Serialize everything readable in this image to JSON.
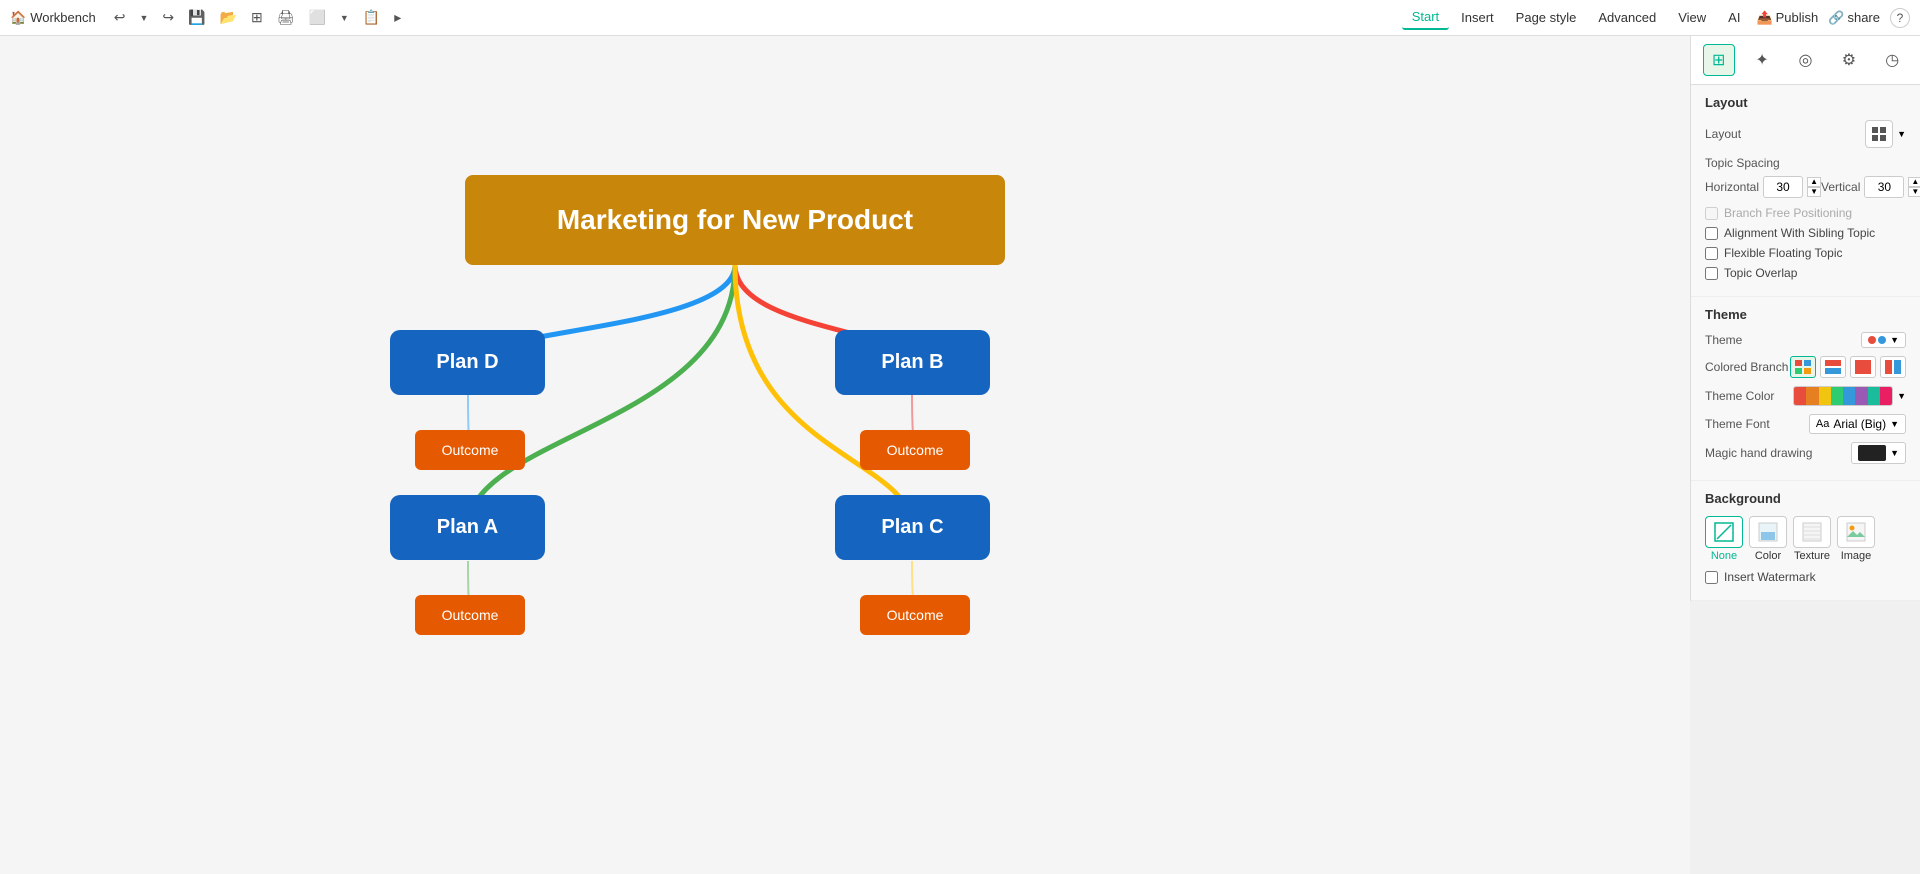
{
  "toolbar": {
    "brand": "Workbench",
    "menus": [
      {
        "label": "Start",
        "active": true
      },
      {
        "label": "Insert",
        "active": false
      },
      {
        "label": "Page style",
        "active": false
      },
      {
        "label": "Advanced",
        "active": false
      },
      {
        "label": "View",
        "active": false
      },
      {
        "label": "AI",
        "active": false
      }
    ],
    "publish_label": "Publish",
    "share_label": "share",
    "help_label": "?"
  },
  "mindmap": {
    "title": "Marketing for New Product",
    "nodes": [
      {
        "id": "planD",
        "label": "Plan D"
      },
      {
        "id": "planB",
        "label": "Plan B"
      },
      {
        "id": "planA",
        "label": "Plan A"
      },
      {
        "id": "planC",
        "label": "Plan C"
      }
    ],
    "outcomes": [
      {
        "id": "outcomeD",
        "label": "Outcome"
      },
      {
        "id": "outcomeB",
        "label": "Outcome"
      },
      {
        "id": "outcomeA",
        "label": "Outcome"
      },
      {
        "id": "outcomeC",
        "label": "Outcome"
      }
    ]
  },
  "panel": {
    "tabs": [
      {
        "id": "layout-tab",
        "icon": "⊞",
        "active": true
      },
      {
        "id": "magic-tab",
        "icon": "✦",
        "active": false
      },
      {
        "id": "target-tab",
        "icon": "◎",
        "active": false
      },
      {
        "id": "gear-tab",
        "icon": "⚙",
        "active": false
      },
      {
        "id": "clock-tab",
        "icon": "◷",
        "active": false
      }
    ],
    "layout_section": {
      "title": "Layout",
      "layout_label": "Layout",
      "topic_spacing_label": "Topic Spacing",
      "horizontal_label": "Horizontal",
      "horizontal_value": "30",
      "vertical_label": "Vertical",
      "vertical_value": "30",
      "checkboxes": [
        {
          "label": "Branch Free Positioning",
          "checked": false,
          "disabled": true
        },
        {
          "label": "Alignment With Sibling Topic",
          "checked": false
        },
        {
          "label": "Flexible Floating Topic",
          "checked": false
        },
        {
          "label": "Topic Overlap",
          "checked": false
        }
      ]
    },
    "theme_section": {
      "title": "Theme",
      "theme_label": "Theme",
      "colored_branch_label": "Colored Branch",
      "theme_color_label": "Theme Color",
      "theme_font_label": "Theme Font",
      "font_value": "Arial (Big)",
      "magic_hand_label": "Magic hand drawing",
      "colored_branch_options": [
        "⊞",
        "⊠",
        "⊡",
        "⊟"
      ],
      "color_stripes": [
        "#e74c3c",
        "#e67e22",
        "#f1c40f",
        "#2ecc71",
        "#3498db",
        "#9b59b6",
        "#1abc9c",
        "#e91e63"
      ]
    },
    "background_section": {
      "title": "Background",
      "options": [
        {
          "label": "None",
          "icon": "◻",
          "active": true
        },
        {
          "label": "Color",
          "icon": "🎨",
          "active": false
        },
        {
          "label": "Texture",
          "icon": "▦",
          "active": false
        },
        {
          "label": "Image",
          "icon": "🖼",
          "active": false
        }
      ],
      "watermark_label": "Insert Watermark",
      "watermark_checked": false
    }
  }
}
